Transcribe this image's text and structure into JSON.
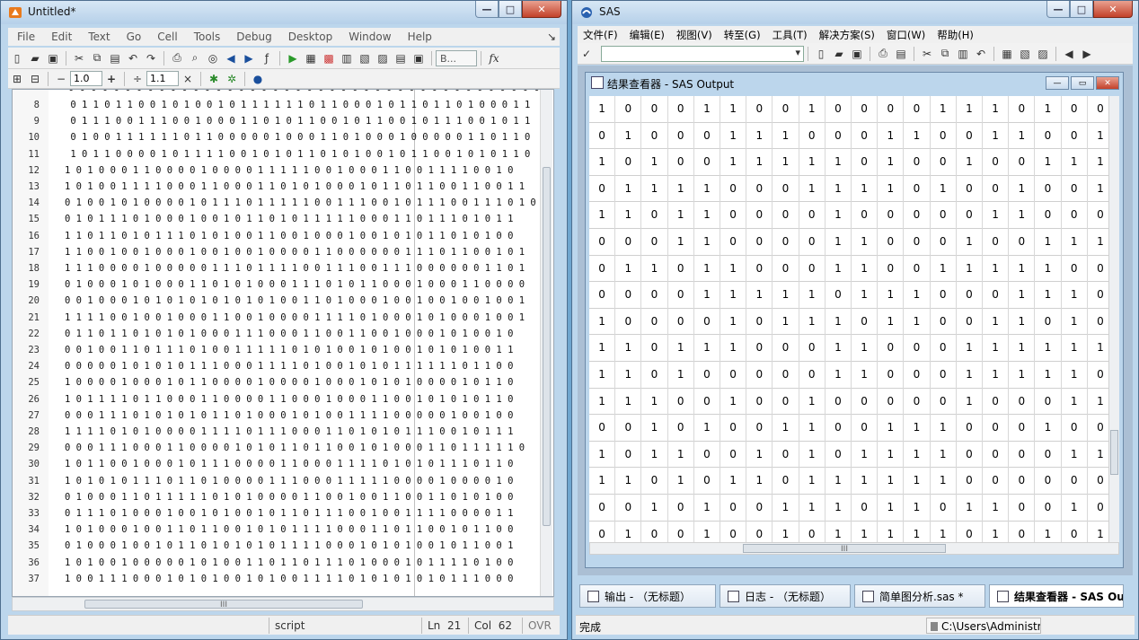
{
  "left_window": {
    "title": "Untitled*",
    "menu": [
      "File",
      "Edit",
      "Text",
      "Go",
      "Cell",
      "Tools",
      "Debug",
      "Desktop",
      "Window",
      "Help"
    ],
    "font_combo": "B...",
    "fx_label": "fx",
    "minus_label": "−",
    "plus_label": "+",
    "divide_label": "÷",
    "times_label": "×",
    "cell_step_1": "1.0",
    "cell_step_2": "1.1",
    "first_line_partial": "0 0 0 0 0 0 0 0 0 0 0 0 0 0 0 0 0 0 0 0 0 0 0 0 0 0 0 0 0 0 0 0 0 0 0 0 0 0 0 0 0 0 0 0 0 0 0 0 0 0 0 0 0 0 0 0 0 0 0",
    "lines": [
      {
        "n": "8",
        "t": " 0 1 1 0 1 1 0 0 1 0 1 0 0 1 0 1 1 1 1 1 1 0 1 1 0 0 0 1 0 1 1 0 1 1 0 1 0 0 0 1 1"
      },
      {
        "n": "9",
        "t": " 0 1 1 1 0 0 1 1 1 0 0 1 0 0 0 1 1 0 1 0 1 1 0 0 1 0 1 1 0 0 1 0 1 1 1 0 0 1 0 1 1"
      },
      {
        "n": "10",
        "t": " 0 1 0 0 1 1 1 1 1 1 0 1 1 0 0 0 0 0 1 0 0 0 1 1 0 1 0 0 0 1 0 0 0 0 0 1 1 0 1 1 0"
      },
      {
        "n": "11",
        "t": " 1 0 1 1 0 0 0 0 1 0 1 1 1 1 0 0 1 0 1 0 1 1 0 1 0 1 0 0 1 0 1 1 0 0 1 0 1 0 1 1 0"
      },
      {
        "n": "12",
        "t": "1 0 1 0 0 0 1 1 0 0 0 0 1 0 0 0 0 1 1 1 1 1 0 0 1 0 0 0 1 1 0 0 1 1 1 1 0 0 1 0"
      },
      {
        "n": "13",
        "t": "1 0 1 0 0 1 1 1 1 0 0 0 1 1 0 0 0 1 1 0 1 0 1 0 0 0 1 0 1 1 0 1 1 0 0 1 1 0 0 1 1"
      },
      {
        "n": "14",
        "t": "0 1 0 0 1 0 1 0 0 0 0 1 0 1 1 1 0 1 1 1 1 1 0 0 1 1 1 0 0 1 0 1 1 1 0 0 1 1 1 0 1 0"
      },
      {
        "n": "15",
        "t": "0 1 0 1 1 1 0 1 0 0 0 1 0 0 1 0 1 1 0 1 0 1 1 1 1 1 0 0 0 1 1 0 1 1 1 0 1 0 1 1"
      },
      {
        "n": "16",
        "t": "1 1 0 1 1 0 1 0 1 1 1 0 1 0 1 0 0 1 1 0 0 1 0 0 0 1 0 0 1 0 1 0 1 1 0 1 0 1 0 0"
      },
      {
        "n": "17",
        "t": "1 1 0 0 1 0 0 1 0 0 0 1 0 0 1 0 0 1 0 0 0 0 1 1 0 0 0 0 0 0 1 1 1 0 1 1 0 0 1 0 1"
      },
      {
        "n": "18",
        "t": "1 1 1 0 0 0 0 1 0 0 0 0 0 1 1 1 0 1 1 1 1 0 0 1 1 1 0 0 1 1 1 0 0 0 0 0 0 1 1 0 1"
      },
      {
        "n": "19",
        "t": "0 1 0 0 0 1 0 1 0 0 0 1 1 0 1 0 1 0 0 0 1 1 1 0 1 0 1 1 0 0 0 1 0 0 0 1 1 0 0 0 0"
      },
      {
        "n": "20",
        "t": "0 0 1 0 0 0 1 0 1 0 1 0 1 0 1 0 1 0 1 0 0 1 1 0 1 0 0 0 1 0 0 1 0 0 1 0 0 1 0 0 1"
      },
      {
        "n": "21",
        "t": "1 1 1 1 0 0 1 0 0 1 0 0 0 1 1 0 0 1 0 0 0 0 1 1 1 1 0 1 0 0 0 1 0 1 0 0 0 1 0 0 1"
      },
      {
        "n": "22",
        "t": "0 1 1 0 1 1 0 1 0 1 0 1 0 0 0 1 1 1 0 0 0 1 1 0 0 1 1 0 0 1 0 0 0 1 0 1 0 0 1 0"
      },
      {
        "n": "23",
        "t": "0 0 1 0 0 1 1 0 1 1 1 0 1 0 0 1 1 1 1 1 0 1 0 1 0 0 1 0 1 0 0 1 0 1 0 1 0 0 1 1"
      },
      {
        "n": "24",
        "t": "0 0 0 0 0 1 0 1 0 1 0 1 1 1 0 0 0 1 1 1 1 0 1 0 0 1 0 1 0 1 1 1 1 1 1 0 1 1 0 0"
      },
      {
        "n": "25",
        "t": "1 0 0 0 0 1 0 0 0 1 0 1 1 0 0 0 0 1 0 0 0 0 1 0 0 0 1 0 1 0 1 0 0 0 0 1 0 1 1 0"
      },
      {
        "n": "26",
        "t": "1 0 1 1 1 1 0 1 1 0 0 0 1 1 0 0 0 0 1 1 0 0 0 1 0 0 0 1 1 0 0 1 0 1 0 1 0 1 1 0"
      },
      {
        "n": "27",
        "t": "0 0 0 1 1 1 0 1 0 1 0 1 0 1 1 0 1 0 0 0 1 0 1 0 0 1 1 1 1 0 0 0 0 0 1 0 0 1 0 0"
      },
      {
        "n": "28",
        "t": "1 1 1 1 0 1 0 1 0 0 0 0 1 1 1 1 0 1 1 1 0 0 0 1 1 0 1 0 1 0 1 1 1 0 0 1 0 1 1 1"
      },
      {
        "n": "29",
        "t": "0 0 0 1 1 1 0 0 0 1 1 0 0 0 0 1 0 1 0 1 1 0 1 1 0 0 1 0 1 0 0 0 1 1 0 1 1 1 1 1 0"
      },
      {
        "n": "30",
        "t": "1 0 1 1 0 0 1 0 0 0 1 0 1 1 1 0 0 0 0 1 1 0 0 0 1 1 1 1 0 1 0 1 0 1 1 1 0 1 1 0"
      },
      {
        "n": "31",
        "t": "1 0 1 0 1 0 1 1 1 0 1 1 0 1 0 0 0 0 1 1 1 0 0 0 1 1 1 1 1 0 0 0 0 1 0 0 0 0 1 0"
      },
      {
        "n": "32",
        "t": "0 1 0 0 0 1 1 0 1 1 1 1 1 0 1 0 1 0 0 0 0 1 1 0 0 1 0 0 1 1 0 0 1 1 0 1 0 1 0 0"
      },
      {
        "n": "33",
        "t": "0 1 1 1 0 1 0 0 0 1 0 0 1 0 1 0 0 1 0 1 1 0 1 1 1 0 0 1 0 0 1 1 1 1 0 0 0 0 1 1"
      },
      {
        "n": "34",
        "t": "1 0 1 0 0 0 1 0 0 1 1 0 1 1 0 0 1 0 1 0 1 1 1 1 0 0 0 1 1 0 1 1 0 0 1 0 1 1 0 0"
      },
      {
        "n": "35",
        "t": "0 1 0 0 0 1 0 0 1 0 1 1 0 1 0 1 0 1 0 1 1 1 1 0 0 0 1 0 1 0 1 0 0 1 0 1 1 0 0 1"
      },
      {
        "n": "36",
        "t": "1 0 1 0 0 1 0 0 0 0 0 1 0 1 0 0 1 1 0 1 1 0 1 1 1 0 1 0 0 0 1 0 1 1 1 1 0 1 0 0"
      },
      {
        "n": "37",
        "t": "1 0 0 1 1 1 0 0 0 1 0 1 0 1 0 0 1 0 1 0 0 1 1 1 1 0 1 0 1 0 1 0 1 0 1 1 1 0 0 0"
      }
    ],
    "status": {
      "mode": "script",
      "ln_label": "Ln",
      "ln": "21",
      "col_label": "Col",
      "col": "62",
      "ovr": "OVR"
    },
    "hscroll_mid": "III"
  },
  "right_window": {
    "title": "SAS",
    "menu": [
      "文件(F)",
      "编辑(E)",
      "视图(V)",
      "转至(G)",
      "工具(T)",
      "解决方案(S)",
      "窗口(W)",
      "帮助(H)"
    ],
    "check_label": "✓",
    "child": {
      "title": "结果查看器 - SAS Output",
      "rows": [
        [
          "1",
          "0",
          "0",
          "0",
          "1",
          "1",
          "0",
          "0",
          "1",
          "0",
          "0",
          "0",
          "0",
          "1",
          "1",
          "1",
          "0",
          "1",
          "0",
          "0"
        ],
        [
          "0",
          "1",
          "0",
          "0",
          "0",
          "1",
          "1",
          "1",
          "0",
          "0",
          "0",
          "1",
          "1",
          "0",
          "0",
          "1",
          "1",
          "0",
          "0",
          "1"
        ],
        [
          "1",
          "0",
          "1",
          "0",
          "0",
          "1",
          "1",
          "1",
          "1",
          "1",
          "0",
          "1",
          "0",
          "0",
          "1",
          "0",
          "0",
          "1",
          "1",
          "1"
        ],
        [
          "0",
          "1",
          "1",
          "1",
          "1",
          "0",
          "0",
          "0",
          "1",
          "1",
          "1",
          "1",
          "0",
          "1",
          "0",
          "0",
          "1",
          "0",
          "0",
          "1"
        ],
        [
          "1",
          "1",
          "0",
          "1",
          "1",
          "0",
          "0",
          "0",
          "0",
          "1",
          "0",
          "0",
          "0",
          "0",
          "0",
          "1",
          "1",
          "0",
          "0",
          "0"
        ],
        [
          "0",
          "0",
          "0",
          "1",
          "1",
          "0",
          "0",
          "0",
          "0",
          "1",
          "1",
          "0",
          "0",
          "0",
          "1",
          "0",
          "0",
          "1",
          "1",
          "1"
        ],
        [
          "0",
          "1",
          "1",
          "0",
          "1",
          "1",
          "0",
          "0",
          "0",
          "1",
          "1",
          "0",
          "0",
          "1",
          "1",
          "1",
          "1",
          "1",
          "0",
          "0"
        ],
        [
          "0",
          "0",
          "0",
          "0",
          "1",
          "1",
          "1",
          "1",
          "1",
          "0",
          "1",
          "1",
          "1",
          "0",
          "0",
          "0",
          "1",
          "1",
          "1",
          "0"
        ],
        [
          "1",
          "0",
          "0",
          "0",
          "0",
          "1",
          "0",
          "1",
          "1",
          "1",
          "0",
          "1",
          "1",
          "0",
          "0",
          "1",
          "1",
          "0",
          "1",
          "0"
        ],
        [
          "1",
          "1",
          "0",
          "1",
          "1",
          "1",
          "0",
          "0",
          "0",
          "1",
          "1",
          "0",
          "0",
          "0",
          "1",
          "1",
          "1",
          "1",
          "1",
          "1"
        ],
        [
          "1",
          "1",
          "0",
          "1",
          "0",
          "0",
          "0",
          "0",
          "0",
          "1",
          "1",
          "0",
          "0",
          "0",
          "1",
          "1",
          "1",
          "1",
          "1",
          "0"
        ],
        [
          "1",
          "1",
          "1",
          "0",
          "0",
          "1",
          "0",
          "0",
          "1",
          "0",
          "0",
          "0",
          "0",
          "0",
          "1",
          "0",
          "0",
          "0",
          "1",
          "1"
        ],
        [
          "0",
          "0",
          "1",
          "0",
          "1",
          "0",
          "0",
          "1",
          "1",
          "0",
          "0",
          "1",
          "1",
          "1",
          "0",
          "0",
          "0",
          "1",
          "0",
          "0"
        ],
        [
          "1",
          "0",
          "1",
          "1",
          "0",
          "0",
          "1",
          "0",
          "1",
          "0",
          "1",
          "1",
          "1",
          "1",
          "0",
          "0",
          "0",
          "0",
          "1",
          "1"
        ],
        [
          "1",
          "1",
          "0",
          "1",
          "0",
          "1",
          "1",
          "0",
          "1",
          "1",
          "1",
          "1",
          "1",
          "1",
          "0",
          "0",
          "0",
          "0",
          "0",
          "0"
        ],
        [
          "0",
          "0",
          "1",
          "0",
          "1",
          "0",
          "0",
          "1",
          "1",
          "1",
          "0",
          "1",
          "1",
          "0",
          "1",
          "1",
          "0",
          "0",
          "1",
          "0"
        ],
        [
          "0",
          "1",
          "0",
          "0",
          "1",
          "0",
          "0",
          "1",
          "0",
          "1",
          "1",
          "1",
          "1",
          "1",
          "0",
          "1",
          "0",
          "1",
          "0",
          "1"
        ]
      ],
      "hscroll_mid": "III"
    },
    "tasks": [
      {
        "label": "输出 - （无标题）"
      },
      {
        "label": "日志 - （无标题）"
      },
      {
        "label": "简单图分析.sas *"
      },
      {
        "label": "结果查看器 - SAS Out..."
      }
    ],
    "status_left": "完成",
    "status_path": "C:\\Users\\Administra"
  },
  "colors": {
    "accent": "#bcd6ec",
    "close": "#c3412a"
  }
}
